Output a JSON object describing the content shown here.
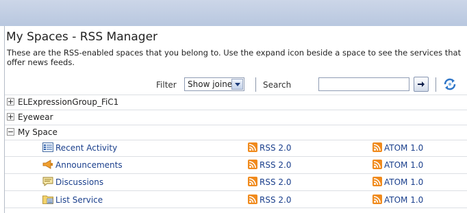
{
  "page": {
    "title": "My Spaces - RSS Manager",
    "description": "These are the RSS-enabled spaces that you belong to. Use the expand icon beside a space to see the services that offer news feeds."
  },
  "toolbar": {
    "filter_label": "Filter",
    "filter_value": "Show joined",
    "search_label": "Search",
    "search_value": ""
  },
  "spaces": [
    {
      "name": "ELExpressionGroup_FiC1",
      "expanded": false
    },
    {
      "name": "Eyewear",
      "expanded": false
    },
    {
      "name": "My Space",
      "expanded": true
    }
  ],
  "services": [
    {
      "name": "Recent Activity",
      "icon": "recent-activity-icon",
      "rss": "RSS 2.0",
      "atom": "ATOM 1.0"
    },
    {
      "name": "Announcements",
      "icon": "announcements-icon",
      "rss": "RSS 2.0",
      "atom": "ATOM 1.0"
    },
    {
      "name": "Discussions",
      "icon": "discussions-icon",
      "rss": "RSS 2.0",
      "atom": "ATOM 1.0"
    },
    {
      "name": "List Service",
      "icon": "list-service-icon",
      "rss": "RSS 2.0",
      "atom": "ATOM 1.0"
    }
  ],
  "colors": {
    "link": "#1a3f8c",
    "feed_orange": "#f08a1c",
    "banner": "#c4d0e6"
  }
}
